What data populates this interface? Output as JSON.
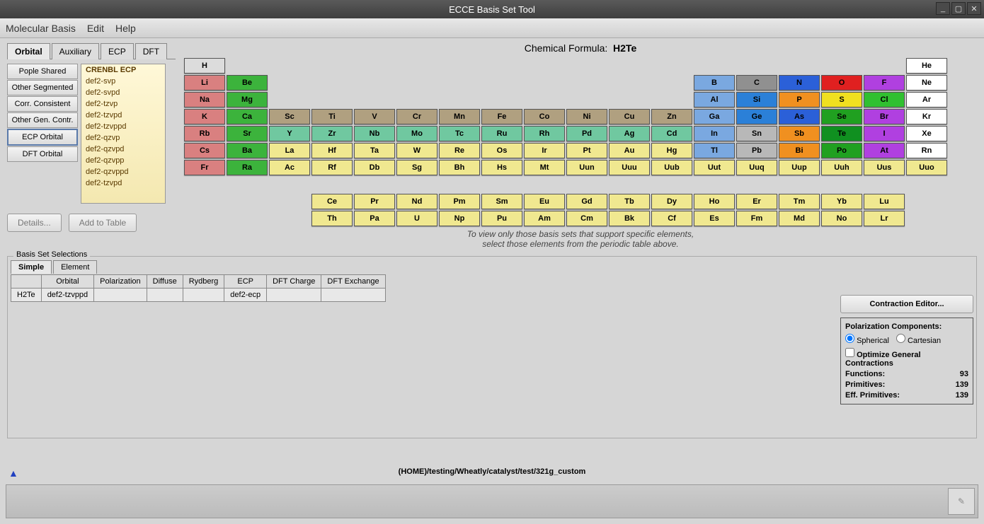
{
  "title": "ECCE Basis Set Tool",
  "menu": [
    "Molecular Basis",
    "Edit",
    "Help"
  ],
  "tabs": [
    "Orbital",
    "Auxiliary",
    "ECP",
    "DFT"
  ],
  "activeTab": 0,
  "catButtons": [
    "Pople Shared",
    "Other Segmented",
    "Corr. Consistent",
    "Other Gen. Contr.",
    "ECP Orbital",
    "DFT Orbital"
  ],
  "catSelected": 4,
  "basisList": [
    "CRENBL ECP",
    "def2-svp",
    "def2-svpd",
    "def2-tzvp",
    "def2-tzvpd",
    "def2-tzvppd",
    "def2-qzvp",
    "def2-qzvpd",
    "def2-qzvpp",
    "def2-qzvppd",
    "def2-tzvpd"
  ],
  "basisSelected": 0,
  "detailsLabel": "Details...",
  "addLabel": "Add to Table",
  "formulaLabel": "Chemical Formula:",
  "formulaValue": "H2Te",
  "hint1": "To view only those basis sets that support specific elements,",
  "hint2": "select those elements from the periodic table above.",
  "bssLegend": "Basis Set Selections",
  "selTabs": [
    "Simple",
    "Element"
  ],
  "selActive": 0,
  "selCols": [
    "",
    "Orbital",
    "Polarization",
    "Diffuse",
    "Rydberg",
    "ECP",
    "DFT Charge",
    "DFT Exchange"
  ],
  "selRow": [
    "H2Te",
    "def2-tzvppd",
    "",
    "",
    "",
    "def2-ecp",
    "",
    ""
  ],
  "ceLabel": "Contraction Editor...",
  "polLabel": "Polarization Components:",
  "sphLabel": "Spherical",
  "cartLabel": "Cartesian",
  "optLabel": "Optimize General Contractions",
  "funcLabel": "Functions:",
  "funcVal": "93",
  "primLabel": "Primitives:",
  "primVal": "139",
  "effLabel": "Eff. Primitives:",
  "effVal": "139",
  "path": "(HOME)/testing/Wheatly/catalyst/test/321g_custom",
  "elements": [
    {
      "s": "H",
      "r": 0,
      "c": 0,
      "bg": "#dcdcdc"
    },
    {
      "s": "He",
      "r": 0,
      "c": 17,
      "bg": "#ffffff"
    },
    {
      "s": "Li",
      "r": 1,
      "c": 0,
      "bg": "#d98080"
    },
    {
      "s": "Be",
      "r": 1,
      "c": 1,
      "bg": "#3cb33c"
    },
    {
      "s": "B",
      "r": 1,
      "c": 12,
      "bg": "#7aa8e0"
    },
    {
      "s": "C",
      "r": 1,
      "c": 13,
      "bg": "#909090"
    },
    {
      "s": "N",
      "r": 1,
      "c": 14,
      "bg": "#2b60d8"
    },
    {
      "s": "O",
      "r": 1,
      "c": 15,
      "bg": "#e02020"
    },
    {
      "s": "F",
      "r": 1,
      "c": 16,
      "bg": "#b040e0"
    },
    {
      "s": "Ne",
      "r": 1,
      "c": 17,
      "bg": "#ffffff"
    },
    {
      "s": "Na",
      "r": 2,
      "c": 0,
      "bg": "#d98080"
    },
    {
      "s": "Mg",
      "r": 2,
      "c": 1,
      "bg": "#3cb33c"
    },
    {
      "s": "Al",
      "r": 2,
      "c": 12,
      "bg": "#7aa8e0"
    },
    {
      "s": "Si",
      "r": 2,
      "c": 13,
      "bg": "#2b80d8"
    },
    {
      "s": "P",
      "r": 2,
      "c": 14,
      "bg": "#f09020"
    },
    {
      "s": "S",
      "r": 2,
      "c": 15,
      "bg": "#f0e020"
    },
    {
      "s": "Cl",
      "r": 2,
      "c": 16,
      "bg": "#30c030"
    },
    {
      "s": "Ar",
      "r": 2,
      "c": 17,
      "bg": "#ffffff"
    },
    {
      "s": "K",
      "r": 3,
      "c": 0,
      "bg": "#d98080"
    },
    {
      "s": "Ca",
      "r": 3,
      "c": 1,
      "bg": "#3cb33c"
    },
    {
      "s": "Sc",
      "r": 3,
      "c": 2,
      "bg": "#b0a080"
    },
    {
      "s": "Ti",
      "r": 3,
      "c": 3,
      "bg": "#b0a080"
    },
    {
      "s": "V",
      "r": 3,
      "c": 4,
      "bg": "#b0a080"
    },
    {
      "s": "Cr",
      "r": 3,
      "c": 5,
      "bg": "#b0a080"
    },
    {
      "s": "Mn",
      "r": 3,
      "c": 6,
      "bg": "#b0a080"
    },
    {
      "s": "Fe",
      "r": 3,
      "c": 7,
      "bg": "#b0a080"
    },
    {
      "s": "Co",
      "r": 3,
      "c": 8,
      "bg": "#b0a080"
    },
    {
      "s": "Ni",
      "r": 3,
      "c": 9,
      "bg": "#b0a080"
    },
    {
      "s": "Cu",
      "r": 3,
      "c": 10,
      "bg": "#b0a080"
    },
    {
      "s": "Zn",
      "r": 3,
      "c": 11,
      "bg": "#b0a080"
    },
    {
      "s": "Ga",
      "r": 3,
      "c": 12,
      "bg": "#7aa8e0"
    },
    {
      "s": "Ge",
      "r": 3,
      "c": 13,
      "bg": "#2b80d8"
    },
    {
      "s": "As",
      "r": 3,
      "c": 14,
      "bg": "#2b60d8"
    },
    {
      "s": "Se",
      "r": 3,
      "c": 15,
      "bg": "#20a020"
    },
    {
      "s": "Br",
      "r": 3,
      "c": 16,
      "bg": "#b040e0"
    },
    {
      "s": "Kr",
      "r": 3,
      "c": 17,
      "bg": "#ffffff"
    },
    {
      "s": "Rb",
      "r": 4,
      "c": 0,
      "bg": "#d98080"
    },
    {
      "s": "Sr",
      "r": 4,
      "c": 1,
      "bg": "#3cb33c"
    },
    {
      "s": "Y",
      "r": 4,
      "c": 2,
      "bg": "#70c8a0"
    },
    {
      "s": "Zr",
      "r": 4,
      "c": 3,
      "bg": "#70c8a0"
    },
    {
      "s": "Nb",
      "r": 4,
      "c": 4,
      "bg": "#70c8a0"
    },
    {
      "s": "Mo",
      "r": 4,
      "c": 5,
      "bg": "#70c8a0"
    },
    {
      "s": "Tc",
      "r": 4,
      "c": 6,
      "bg": "#70c8a0"
    },
    {
      "s": "Ru",
      "r": 4,
      "c": 7,
      "bg": "#70c8a0"
    },
    {
      "s": "Rh",
      "r": 4,
      "c": 8,
      "bg": "#70c8a0"
    },
    {
      "s": "Pd",
      "r": 4,
      "c": 9,
      "bg": "#70c8a0"
    },
    {
      "s": "Ag",
      "r": 4,
      "c": 10,
      "bg": "#70c8a0"
    },
    {
      "s": "Cd",
      "r": 4,
      "c": 11,
      "bg": "#70c8a0"
    },
    {
      "s": "In",
      "r": 4,
      "c": 12,
      "bg": "#7aa8e0"
    },
    {
      "s": "Sn",
      "r": 4,
      "c": 13,
      "bg": "#b8b8b8"
    },
    {
      "s": "Sb",
      "r": 4,
      "c": 14,
      "bg": "#f09020"
    },
    {
      "s": "Te",
      "r": 4,
      "c": 15,
      "bg": "#109020"
    },
    {
      "s": "I",
      "r": 4,
      "c": 16,
      "bg": "#b040e0"
    },
    {
      "s": "Xe",
      "r": 4,
      "c": 17,
      "bg": "#ffffff"
    },
    {
      "s": "Cs",
      "r": 5,
      "c": 0,
      "bg": "#d98080"
    },
    {
      "s": "Ba",
      "r": 5,
      "c": 1,
      "bg": "#3cb33c"
    },
    {
      "s": "La",
      "r": 5,
      "c": 2,
      "bg": "#f0e890"
    },
    {
      "s": "Hf",
      "r": 5,
      "c": 3,
      "bg": "#f0e890"
    },
    {
      "s": "Ta",
      "r": 5,
      "c": 4,
      "bg": "#f0e890"
    },
    {
      "s": "W",
      "r": 5,
      "c": 5,
      "bg": "#f0e890"
    },
    {
      "s": "Re",
      "r": 5,
      "c": 6,
      "bg": "#f0e890"
    },
    {
      "s": "Os",
      "r": 5,
      "c": 7,
      "bg": "#f0e890"
    },
    {
      "s": "Ir",
      "r": 5,
      "c": 8,
      "bg": "#f0e890"
    },
    {
      "s": "Pt",
      "r": 5,
      "c": 9,
      "bg": "#f0e890"
    },
    {
      "s": "Au",
      "r": 5,
      "c": 10,
      "bg": "#f0e890"
    },
    {
      "s": "Hg",
      "r": 5,
      "c": 11,
      "bg": "#f0e890"
    },
    {
      "s": "Tl",
      "r": 5,
      "c": 12,
      "bg": "#7aa8e0"
    },
    {
      "s": "Pb",
      "r": 5,
      "c": 13,
      "bg": "#b8b8b8"
    },
    {
      "s": "Bi",
      "r": 5,
      "c": 14,
      "bg": "#f09020"
    },
    {
      "s": "Po",
      "r": 5,
      "c": 15,
      "bg": "#20a020"
    },
    {
      "s": "At",
      "r": 5,
      "c": 16,
      "bg": "#b040e0"
    },
    {
      "s": "Rn",
      "r": 5,
      "c": 17,
      "bg": "#ffffff"
    },
    {
      "s": "Fr",
      "r": 6,
      "c": 0,
      "bg": "#d98080"
    },
    {
      "s": "Ra",
      "r": 6,
      "c": 1,
      "bg": "#3cb33c"
    },
    {
      "s": "Ac",
      "r": 6,
      "c": 2,
      "bg": "#f0e890"
    },
    {
      "s": "Rf",
      "r": 6,
      "c": 3,
      "bg": "#f0e890"
    },
    {
      "s": "Db",
      "r": 6,
      "c": 4,
      "bg": "#f0e890"
    },
    {
      "s": "Sg",
      "r": 6,
      "c": 5,
      "bg": "#f0e890"
    },
    {
      "s": "Bh",
      "r": 6,
      "c": 6,
      "bg": "#f0e890"
    },
    {
      "s": "Hs",
      "r": 6,
      "c": 7,
      "bg": "#f0e890"
    },
    {
      "s": "Mt",
      "r": 6,
      "c": 8,
      "bg": "#f0e890"
    },
    {
      "s": "Uun",
      "r": 6,
      "c": 9,
      "bg": "#f0e890"
    },
    {
      "s": "Uuu",
      "r": 6,
      "c": 10,
      "bg": "#f0e890"
    },
    {
      "s": "Uub",
      "r": 6,
      "c": 11,
      "bg": "#f0e890"
    },
    {
      "s": "Uut",
      "r": 6,
      "c": 12,
      "bg": "#f0e890"
    },
    {
      "s": "Uuq",
      "r": 6,
      "c": 13,
      "bg": "#f0e890"
    },
    {
      "s": "Uup",
      "r": 6,
      "c": 14,
      "bg": "#f0e890"
    },
    {
      "s": "Uuh",
      "r": 6,
      "c": 15,
      "bg": "#f0e890"
    },
    {
      "s": "Uus",
      "r": 6,
      "c": 16,
      "bg": "#f0e890"
    },
    {
      "s": "Uuo",
      "r": 6,
      "c": 17,
      "bg": "#f0e890"
    },
    {
      "s": "Ce",
      "r": 8,
      "c": 3,
      "bg": "#f0e890"
    },
    {
      "s": "Pr",
      "r": 8,
      "c": 4,
      "bg": "#f0e890"
    },
    {
      "s": "Nd",
      "r": 8,
      "c": 5,
      "bg": "#f0e890"
    },
    {
      "s": "Pm",
      "r": 8,
      "c": 6,
      "bg": "#f0e890"
    },
    {
      "s": "Sm",
      "r": 8,
      "c": 7,
      "bg": "#f0e890"
    },
    {
      "s": "Eu",
      "r": 8,
      "c": 8,
      "bg": "#f0e890"
    },
    {
      "s": "Gd",
      "r": 8,
      "c": 9,
      "bg": "#f0e890"
    },
    {
      "s": "Tb",
      "r": 8,
      "c": 10,
      "bg": "#f0e890"
    },
    {
      "s": "Dy",
      "r": 8,
      "c": 11,
      "bg": "#f0e890"
    },
    {
      "s": "Ho",
      "r": 8,
      "c": 12,
      "bg": "#f0e890"
    },
    {
      "s": "Er",
      "r": 8,
      "c": 13,
      "bg": "#f0e890"
    },
    {
      "s": "Tm",
      "r": 8,
      "c": 14,
      "bg": "#f0e890"
    },
    {
      "s": "Yb",
      "r": 8,
      "c": 15,
      "bg": "#f0e890"
    },
    {
      "s": "Lu",
      "r": 8,
      "c": 16,
      "bg": "#f0e890"
    },
    {
      "s": "Th",
      "r": 9,
      "c": 3,
      "bg": "#f0e890"
    },
    {
      "s": "Pa",
      "r": 9,
      "c": 4,
      "bg": "#f0e890"
    },
    {
      "s": "U",
      "r": 9,
      "c": 5,
      "bg": "#f0e890"
    },
    {
      "s": "Np",
      "r": 9,
      "c": 6,
      "bg": "#f0e890"
    },
    {
      "s": "Pu",
      "r": 9,
      "c": 7,
      "bg": "#f0e890"
    },
    {
      "s": "Am",
      "r": 9,
      "c": 8,
      "bg": "#f0e890"
    },
    {
      "s": "Cm",
      "r": 9,
      "c": 9,
      "bg": "#f0e890"
    },
    {
      "s": "Bk",
      "r": 9,
      "c": 10,
      "bg": "#f0e890"
    },
    {
      "s": "Cf",
      "r": 9,
      "c": 11,
      "bg": "#f0e890"
    },
    {
      "s": "Es",
      "r": 9,
      "c": 12,
      "bg": "#f0e890"
    },
    {
      "s": "Fm",
      "r": 9,
      "c": 13,
      "bg": "#f0e890"
    },
    {
      "s": "Md",
      "r": 9,
      "c": 14,
      "bg": "#f0e890"
    },
    {
      "s": "No",
      "r": 9,
      "c": 15,
      "bg": "#f0e890"
    },
    {
      "s": "Lr",
      "r": 9,
      "c": 16,
      "bg": "#f0e890"
    }
  ]
}
